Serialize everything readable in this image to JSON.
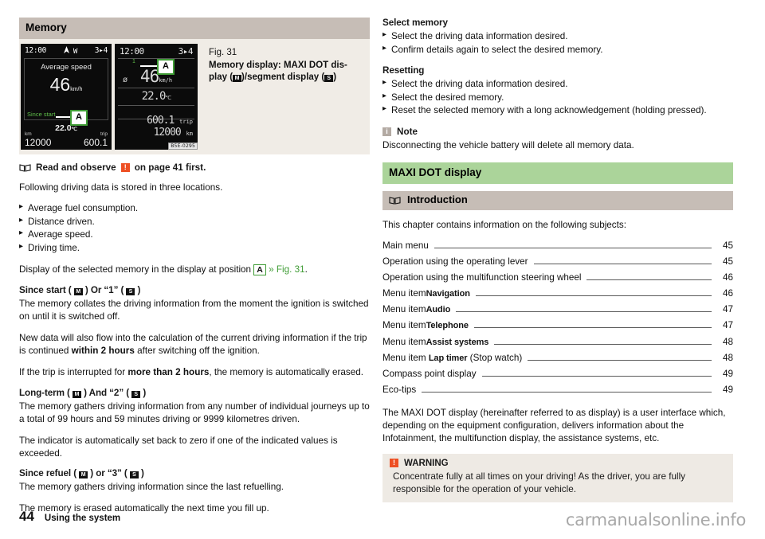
{
  "left": {
    "section_heading": "Memory",
    "figure": {
      "caption_number": "Fig. 31",
      "caption_title": "Memory display: MAXI DOT display (Ⓜ)/segment display (Ⓢ)",
      "caption_title_part1": "Memory display: MAXI DOT dis-",
      "caption_title_part2_pre": "play (",
      "caption_glyph_m": "M",
      "caption_title_part2_mid": ")/segment display (",
      "caption_glyph_s": "S",
      "caption_title_part2_post": ")",
      "code_label": "B5E-0295",
      "callout_label": "A",
      "dot_display": {
        "time": "12:00",
        "gear_indicator": "3▸4",
        "compass": "W",
        "panel_title": "Average speed",
        "value": "46",
        "value_unit": "km/h",
        "memory_label": "Since start",
        "temperature": "22.0",
        "temperature_unit": "℃",
        "odo_label": "km",
        "trip_label": "trip",
        "odo_value": "12000",
        "trip_value": "600.1"
      },
      "segment_display": {
        "time": "12:00",
        "gear_indicator": "3▸4",
        "memory_number": "1",
        "avg_symbol": "ø",
        "value": "46",
        "value_unit": "km/h",
        "temperature": "22.0",
        "temperature_unit": "℃",
        "trip_value": "600.1",
        "trip_label": "trip",
        "odo_value": "12000",
        "odo_label": "km"
      }
    },
    "read_observe": {
      "pre": "Read and observe",
      "post": "on page 41 first."
    },
    "intro_paragraph": "Following driving data is stored in three locations.",
    "bullets": [
      "Average fuel consumption.",
      "Distance driven.",
      "Average speed.",
      "Driving time."
    ],
    "display_position": {
      "pre": "Display of the selected memory in the display at position",
      "marker": "A",
      "xref": "» Fig. 31",
      "post": "."
    },
    "blocks": [
      {
        "heading_pre": "Since start ( ",
        "heading_glyph1": "M",
        "heading_mid": " ) Or “1” ( ",
        "heading_glyph2": "S",
        "heading_post": " )",
        "paragraphs": [
          "The memory collates the driving information from the moment the ignition is switched on until it is switched off."
        ]
      }
    ],
    "para_new_data_pre": "New data will also flow into the calculation of the current driving information if the trip is continued ",
    "para_new_data_bold": "within 2 hours",
    "para_new_data_post": " after switching off the ignition.",
    "para_interrupt_pre": "If the trip is interrupted for ",
    "para_interrupt_bold": "more than 2 hours",
    "para_interrupt_post": ", the memory is automatically erased.",
    "longterm_heading_pre": "Long-term ( ",
    "longterm_glyph1": "M",
    "longterm_mid": " ) And “2” ( ",
    "longterm_glyph2": "S",
    "longterm_post": " )",
    "longterm_para1": "The memory gathers driving information from any number of individual journeys up to a total of 99 hours and 59 minutes driving or 9999 kilometres driven.",
    "longterm_para2": "The indicator is automatically set back to zero if one of the indicated values is exceeded.",
    "refuel_heading_pre": "Since refuel ( ",
    "refuel_glyph1": "M",
    "refuel_mid": " ) or “3” ( ",
    "refuel_glyph2": "S",
    "refuel_post": " )",
    "refuel_para1": "The memory gathers driving information since the last refuelling.",
    "refuel_para2": "The memory is erased automatically the next time you fill up."
  },
  "right": {
    "select_memory": {
      "heading": "Select memory",
      "items": [
        "Select the driving data information desired.",
        "Confirm details again to select the desired memory."
      ]
    },
    "resetting": {
      "heading": "Resetting",
      "items": [
        "Select the driving data information desired.",
        "Select the desired memory.",
        "Reset the selected memory with a long acknowledgement (holding pressed)."
      ]
    },
    "note": {
      "label": "Note",
      "icon_char": "i",
      "text": "Disconnecting the vehicle battery will delete all memory data."
    },
    "chapter_heading": "MAXI DOT display",
    "subsection_heading": "Introduction",
    "toc_intro": "This chapter contains information on the following subjects:",
    "toc": [
      {
        "label": "Main menu",
        "keyword": "",
        "suffix": "",
        "page": "45"
      },
      {
        "label": "Operation using the operating lever",
        "keyword": "",
        "suffix": "",
        "page": "45"
      },
      {
        "label": "Operation using the multifunction steering wheel",
        "keyword": "",
        "suffix": "",
        "page": "46"
      },
      {
        "label": "Menu item",
        "keyword": "Navigation",
        "suffix": "",
        "page": "46"
      },
      {
        "label": "Menu item",
        "keyword": "Audio",
        "suffix": "",
        "page": "47"
      },
      {
        "label": "Menu item",
        "keyword": "Telephone",
        "suffix": "",
        "page": "47"
      },
      {
        "label": "Menu item",
        "keyword": "Assist systems",
        "suffix": "",
        "page": "48"
      },
      {
        "label": "Menu item ",
        "keyword": "Lap timer",
        "suffix": " (Stop watch)",
        "page": "48"
      },
      {
        "label": "Compass point display",
        "keyword": "",
        "suffix": "",
        "page": "49"
      },
      {
        "label": "Eco-tips",
        "keyword": "",
        "suffix": "",
        "page": "49"
      }
    ],
    "description": "The MAXI DOT display (hereinafter referred to as display) is a user interface which, depending on the equipment configuration, delivers information about the Infotainment, the multifunction display, the assistance systems, etc.",
    "warning": {
      "label": "WARNING",
      "icon_char": "!",
      "text": "Concentrate fully at all times on your driving! As the driver, you are fully responsible for the operation of your vehicle."
    }
  },
  "footer": {
    "page_number": "44",
    "running_head": "Using the system",
    "watermark": "carmanualsonline.info"
  },
  "colors": {
    "heading_bar": "#c6bdb6",
    "chapter_bar": "#abd49a",
    "figure_bg": "#f0ece6",
    "warning": "#ee4f23",
    "note": "#b3aaa3",
    "accent_green": "#3f9c35"
  }
}
